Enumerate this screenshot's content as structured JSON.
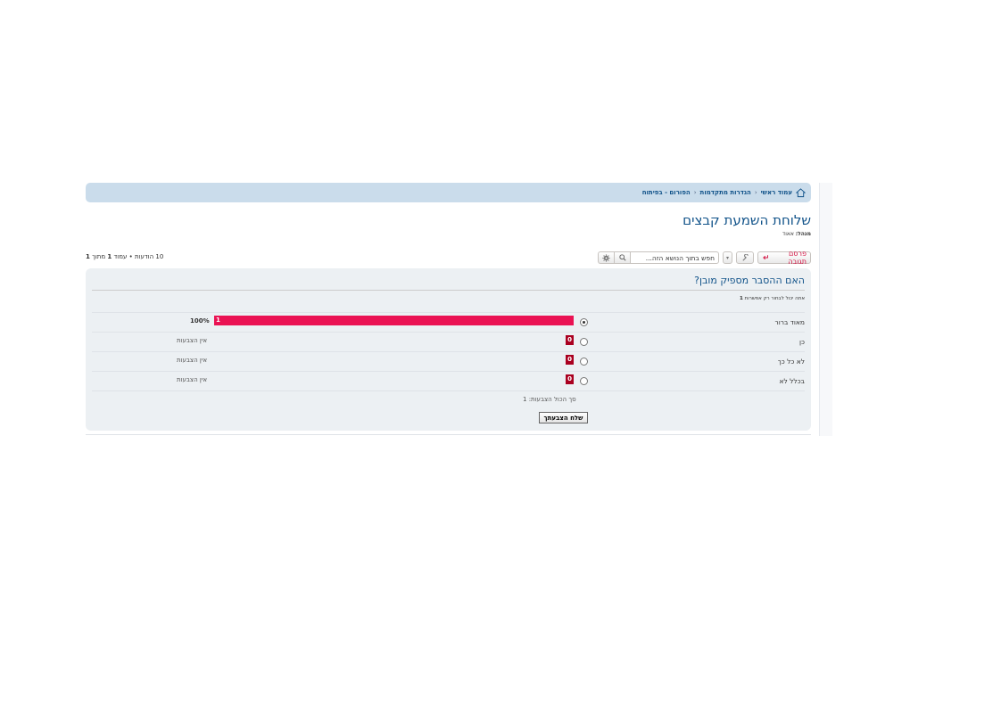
{
  "breadcrumb": {
    "items": [
      "עמוד ראשי",
      "הגדרות מתקדמות",
      "הפורום - בפיתוח"
    ],
    "separator": "‹"
  },
  "topic": {
    "title": "שלוחת השמעת קבצים",
    "moderators_label": "מנהל:",
    "moderator_name": "אאוד"
  },
  "actions": {
    "reply_label": "פרסם תגובה",
    "search_placeholder": "חפש בתוך הנושא הזה..."
  },
  "pagination": {
    "posts": "10 הודעות",
    "bullet": "•",
    "page_word": "עמוד",
    "current_page": "1",
    "of_word": "מתוך",
    "total_pages": "1"
  },
  "poll": {
    "question": "האם ההסבר מספיק מובן?",
    "note_prefix": "אתה יכול לבחור רק אפשרות",
    "note_count": "1",
    "options": [
      {
        "label": "מאוד ברור",
        "votes": "1",
        "percent": "100%",
        "fraction": 1.0,
        "selected": true
      },
      {
        "label": "כן",
        "votes": "0",
        "status": "אין הצבעות",
        "fraction": 0,
        "selected": false
      },
      {
        "label": "לא כל כך",
        "votes": "0",
        "status": "אין הצבעות",
        "fraction": 0,
        "selected": false
      },
      {
        "label": "בכלל לא",
        "votes": "0",
        "status": "אין הצבעות",
        "fraction": 0,
        "selected": false
      }
    ],
    "total_votes": "סך הכול הצבעות: 1",
    "submit_label": "שלח הצבעתך"
  },
  "colors": {
    "bar_fill": "#ea1253",
    "bar_zero": "#aa0020",
    "link": "#105289",
    "breadcrumb_bg": "#cadceb",
    "panel_bg": "#ecf0f3"
  },
  "icons": [
    "home-icon",
    "wrench-icon",
    "caret-down-icon",
    "search-icon",
    "gear-icon",
    "reply-arrow-icon"
  ]
}
